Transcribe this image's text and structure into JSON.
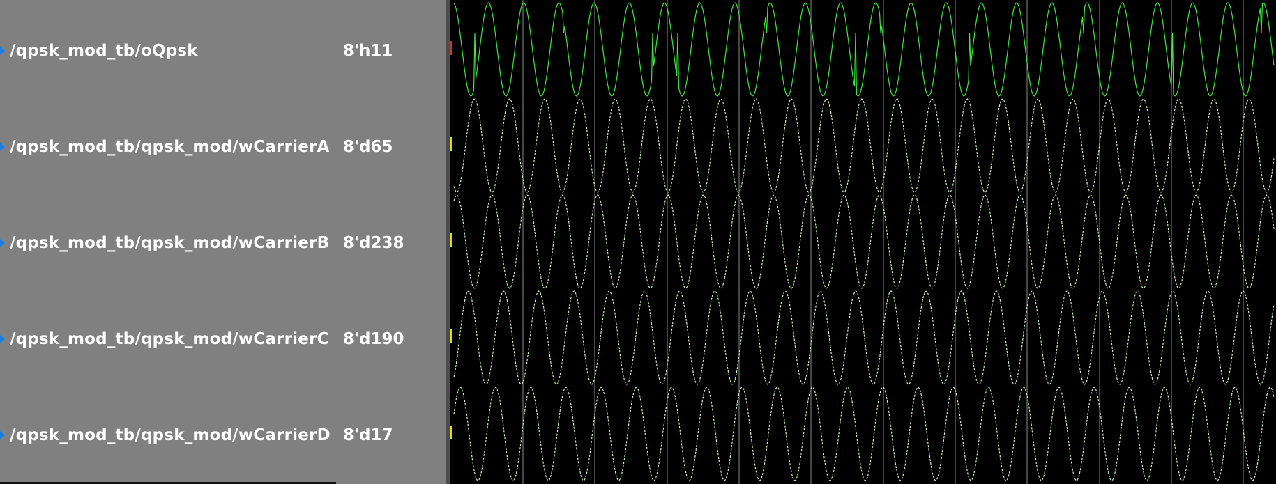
{
  "signals": [
    {
      "name": "/qpsk_mod_tb/oQpsk",
      "value": "8'h11",
      "color": "#3ee63e"
    },
    {
      "name": "/qpsk_mod_tb/qpsk_mod/wCarrierA",
      "value": "8'd65",
      "color": "#c6f5c6"
    },
    {
      "name": "/qpsk_mod_tb/qpsk_mod/wCarrierB",
      "value": "8'd238",
      "color": "#c6f5c6"
    },
    {
      "name": "/qpsk_mod_tb/qpsk_mod/wCarrierC",
      "value": "8'd190",
      "color": "#c6f5c6"
    },
    {
      "name": "/qpsk_mod_tb/qpsk_mod/wCarrierD",
      "value": "8'd17",
      "color": "#c6f5c6"
    }
  ],
  "colors": {
    "pane_bg": "#808080",
    "wave_bg": "#000000",
    "grid": "#8a8a8a",
    "label": "#ffffff",
    "expand_icon": "#1f7fe0",
    "cursor": "#e0e000"
  },
  "expand_icon_name": "expand-arrow-icon"
}
